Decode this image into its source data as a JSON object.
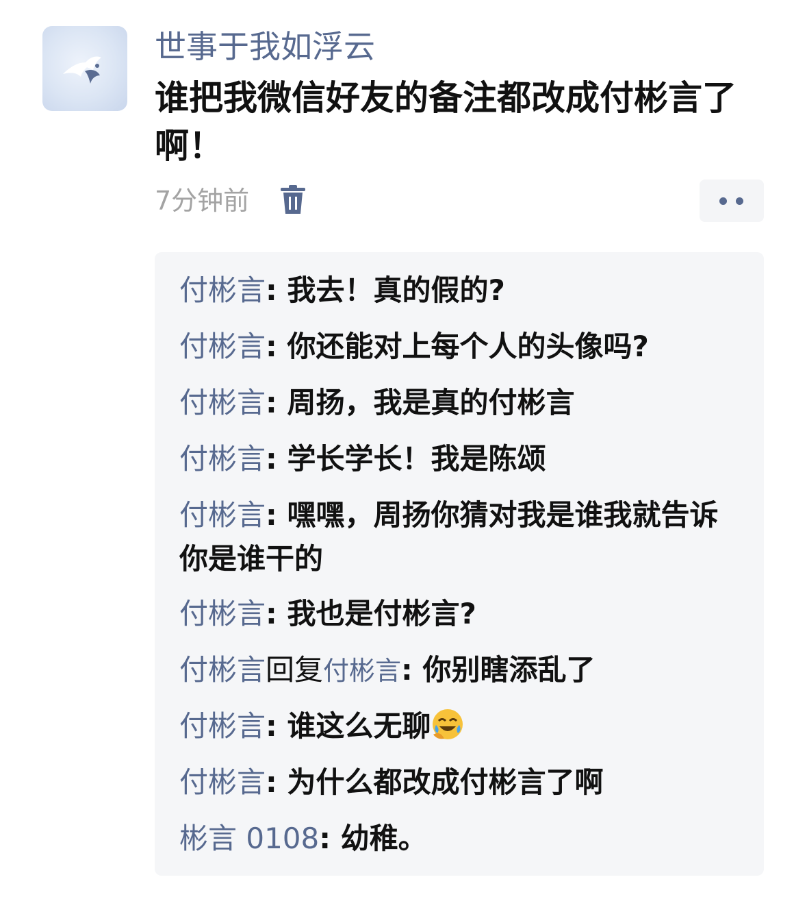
{
  "post": {
    "author": "世事于我如浮云",
    "text": "谁把我微信好友的备注都改成付彬言了啊！",
    "time": "7分钟前",
    "delete_icon": "trash-icon",
    "more_icon": "more-dots-icon"
  },
  "comments": [
    {
      "name": "付彬言",
      "sep": ": ",
      "text": "我去！真的假的?"
    },
    {
      "name": "付彬言",
      "sep": ": ",
      "text": "你还能对上每个人的头像吗?"
    },
    {
      "name": "付彬言",
      "sep": ": ",
      "text": "周扬，我是真的付彬言"
    },
    {
      "name": "付彬言",
      "sep": ": ",
      "text": "学长学长！我是陈颂"
    },
    {
      "name": "付彬言",
      "sep": ": ",
      "text": "嘿嘿，周扬你猜对我是谁我就告诉你是谁干的"
    },
    {
      "name": "付彬言",
      "sep": ": ",
      "text": "我也是付彬言?"
    },
    {
      "name": "付彬言",
      "reply_word": "回复",
      "reply_to": "付彬言",
      "sep": ": ",
      "text": "你别瞎添乱了"
    },
    {
      "name": "付彬言",
      "sep": ": ",
      "text": "谁这么无聊",
      "emoji": "laughing-crying-emoji"
    },
    {
      "name": "付彬言",
      "sep": ": ",
      "text": "为什么都改成付彬言了啊"
    },
    {
      "name": "彬言 0108",
      "sep": ": ",
      "text": "幼稚。"
    }
  ],
  "colors": {
    "link": "#57698f",
    "text": "#111111",
    "muted": "#a3a3a3",
    "comment_bg": "#f5f6f8"
  }
}
